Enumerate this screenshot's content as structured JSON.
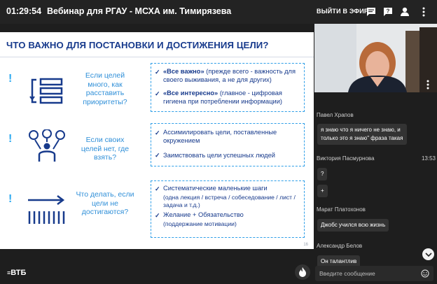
{
  "topbar": {
    "time": "01:29:54",
    "title": "Вебинар для РГАУ - МСХА им. Тимирязева",
    "go_live": "ВЫЙТИ В ЭФИР"
  },
  "slide": {
    "title": "ЧТО ВАЖНО ДЛЯ ПОСТАНОВКИ И ДОСТИЖЕНИЯ ЦЕЛИ?",
    "page_number": "16",
    "rows": [
      {
        "mark": "!",
        "question": "Если целей много, как расставить приоритеты?",
        "items": [
          {
            "check": "✓",
            "bold": "«Все важно»",
            "text": " (прежде всего - важность для своего выживания, а не для других)"
          },
          {
            "check": "✓",
            "bold": "«Все интересно»",
            "text": " (главное - цифровая гигиена при потреблении информации)"
          }
        ]
      },
      {
        "mark": "!",
        "question": "Если своих целей нет, где взять?",
        "items": [
          {
            "check": "✓",
            "bold": "",
            "text": "Ассимилировать цели, поставленные окружением"
          },
          {
            "check": "✓",
            "bold": "",
            "text": "Заимствовать цели успешных людей"
          }
        ]
      },
      {
        "mark": "!",
        "question": "Что делать, если цели не достигаются?",
        "items": [
          {
            "check": "✓",
            "bold": "",
            "text": "Систематические маленькие шаги",
            "sub": "(одна лекция / встреча / собеседование / лист / задача и т.д.)"
          },
          {
            "check": "✓",
            "bold": "",
            "text": "Желание + Обязательство",
            "sub": "(поддержание мотивации)"
          }
        ]
      }
    ]
  },
  "footer": {
    "logo": "ВТБ"
  },
  "chat": {
    "messages": [
      {
        "author": "Павел Храпов",
        "time": "",
        "text": "я знаю что я ничего не знаю, и только это я знаю\" фраза такая"
      },
      {
        "author": "Виктория Пасмурнова",
        "time": "13:53",
        "bubbles": [
          "?",
          "+"
        ]
      },
      {
        "author": "Марат Платохонов",
        "time": "",
        "text": "Джобс учился всю жизнь"
      },
      {
        "author": "Александр Белов",
        "time": "",
        "text": "Он талантлив"
      }
    ],
    "input_placeholder": "Введите сообщение"
  },
  "colors": {
    "slide_title": "#173a8c",
    "accent": "#2f9fe8",
    "background": "#1e1e1e"
  },
  "icons": [
    "chat-icon",
    "question-icon",
    "user-icon",
    "more-vertical-icon",
    "more-vertical-icon",
    "smile-icon",
    "flame-icon",
    "chevron-down-icon"
  ]
}
